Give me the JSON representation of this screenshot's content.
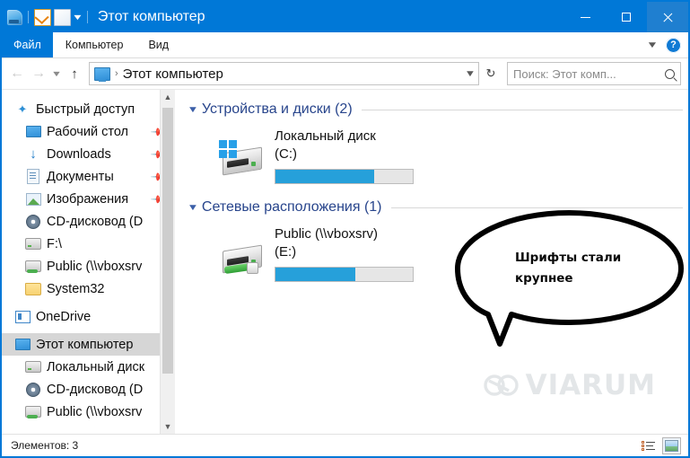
{
  "window": {
    "title": "Этот компьютер",
    "quick_access": [
      {
        "name": "explorer-icon"
      },
      {
        "name": "properties-icon"
      },
      {
        "name": "new-folder-icon"
      }
    ],
    "controls": {
      "minimize": "minimize-button",
      "maximize": "maximize-button",
      "close": "close-button"
    }
  },
  "ribbon": {
    "tabs": [
      {
        "label": "Файл",
        "active": true
      },
      {
        "label": "Компьютер",
        "active": false
      },
      {
        "label": "Вид",
        "active": false
      }
    ],
    "expand_icon": "chevron-down-icon",
    "help_label": "?"
  },
  "address": {
    "back_icon": "back-arrow-icon",
    "forward_icon": "forward-arrow-icon",
    "history_icon": "chevron-down-icon",
    "up_icon": "up-arrow-icon",
    "location": "Этот компьютер",
    "separator": "›",
    "dropdown_icon": "chevron-down-icon",
    "refresh_icon": "refresh-icon"
  },
  "search": {
    "placeholder": "Поиск: Этот комп...",
    "icon": "search-icon"
  },
  "sidebar": {
    "items": [
      {
        "label": "Быстрый доступ",
        "icon": "star-icon",
        "indent": false,
        "pinned": false,
        "selected": false
      },
      {
        "label": "Рабочий стол",
        "icon": "desktop-icon",
        "indent": true,
        "pinned": true,
        "selected": false
      },
      {
        "label": "Downloads",
        "icon": "download-icon",
        "indent": true,
        "pinned": true,
        "selected": false
      },
      {
        "label": "Документы",
        "icon": "documents-icon",
        "indent": true,
        "pinned": true,
        "selected": false
      },
      {
        "label": "Изображения",
        "icon": "pictures-icon",
        "indent": true,
        "pinned": true,
        "selected": false
      },
      {
        "label": "CD-дисковод (D",
        "icon": "cd-drive-icon",
        "indent": true,
        "pinned": false,
        "selected": false
      },
      {
        "label": "F:\\",
        "icon": "drive-icon",
        "indent": true,
        "pinned": false,
        "selected": false
      },
      {
        "label": "Public (\\\\vboxsrv",
        "icon": "network-drive-icon",
        "indent": true,
        "pinned": false,
        "selected": false
      },
      {
        "label": "System32",
        "icon": "folder-icon",
        "indent": true,
        "pinned": false,
        "selected": false
      },
      {
        "label": "OneDrive",
        "icon": "onedrive-icon",
        "indent": false,
        "pinned": false,
        "selected": false
      },
      {
        "label": "Этот компьютер",
        "icon": "computer-icon",
        "indent": false,
        "pinned": false,
        "selected": true
      },
      {
        "label": "Локальный диск",
        "icon": "system-drive-icon",
        "indent": true,
        "pinned": false,
        "selected": false
      },
      {
        "label": "CD-дисковод (D",
        "icon": "cd-drive-icon",
        "indent": true,
        "pinned": false,
        "selected": false
      },
      {
        "label": "Public (\\\\vboxsrv",
        "icon": "network-drive-icon",
        "indent": true,
        "pinned": false,
        "selected": false
      }
    ],
    "scrollbar": {
      "up_icon": "scroll-up-icon",
      "down_icon": "scroll-down-icon"
    }
  },
  "content": {
    "groups": [
      {
        "title": "Устройства и диски (2)",
        "chevron": "chevron-down-icon",
        "items": [
          {
            "name_line1": "Локальный диск",
            "name_line2": "(C:)",
            "icon": "system-drive-icon",
            "usage_percent": 72
          }
        ]
      },
      {
        "title": "Сетевые расположения (1)",
        "chevron": "chevron-down-icon",
        "items": [
          {
            "name_line1": "Public (\\\\vboxsrv)",
            "name_line2": "(E:)",
            "icon": "network-drive-icon",
            "usage_percent": 58
          }
        ]
      }
    ]
  },
  "annotation": {
    "bubble_text_line1": "Шрифты стали",
    "bubble_text_line2": "крупнее"
  },
  "watermark": {
    "text": "VIARUM",
    "logo": "viarum-logo-icon"
  },
  "statusbar": {
    "items_text": "Элементов: 3",
    "view_details_icon": "details-view-icon",
    "view_large_icons_icon": "large-icons-view-icon"
  },
  "colors": {
    "accent": "#0078d7",
    "progress": "#26a0da",
    "group_title": "#28458c",
    "selection": "#d6d6d6"
  }
}
